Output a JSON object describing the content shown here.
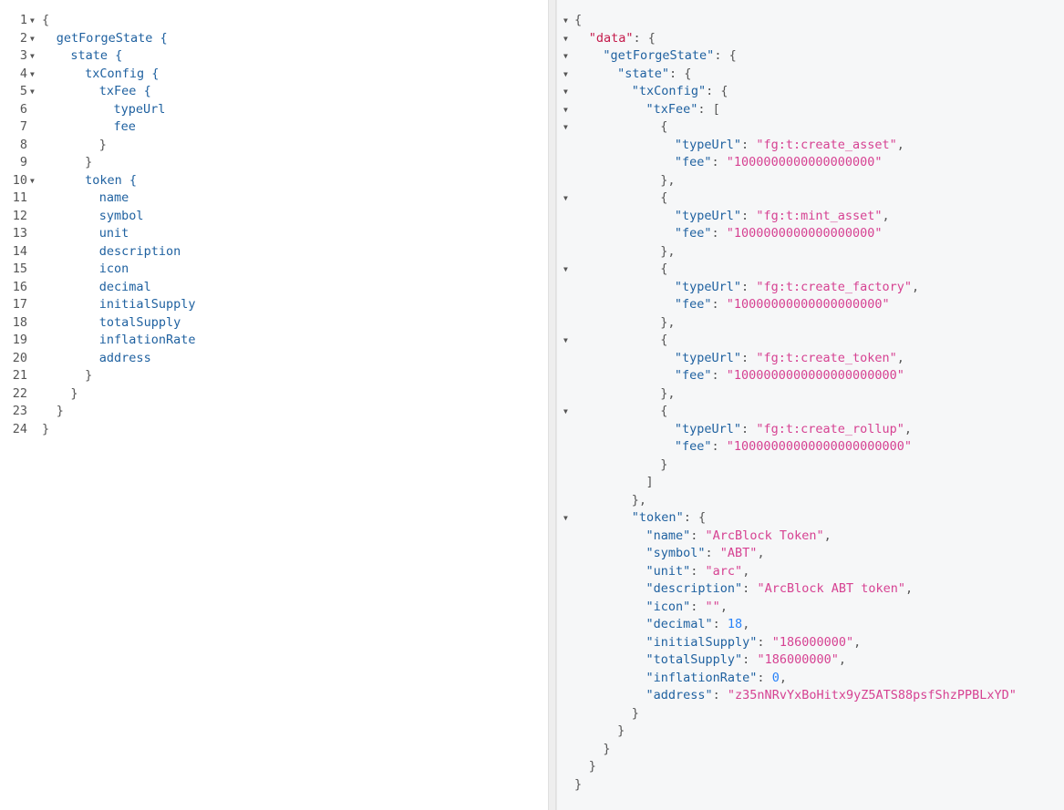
{
  "query_editor": {
    "lines": [
      {
        "n": "1",
        "fold": true,
        "indent": 0,
        "text": "{"
      },
      {
        "n": "2",
        "fold": true,
        "indent": 1,
        "text": "getForgeState {"
      },
      {
        "n": "3",
        "fold": true,
        "indent": 2,
        "text": "state {"
      },
      {
        "n": "4",
        "fold": true,
        "indent": 3,
        "text": "txConfig {"
      },
      {
        "n": "5",
        "fold": true,
        "indent": 4,
        "text": "txFee {"
      },
      {
        "n": "6",
        "fold": false,
        "indent": 5,
        "text": "typeUrl"
      },
      {
        "n": "7",
        "fold": false,
        "indent": 5,
        "text": "fee"
      },
      {
        "n": "8",
        "fold": false,
        "indent": 4,
        "text": "}"
      },
      {
        "n": "9",
        "fold": false,
        "indent": 3,
        "text": "}"
      },
      {
        "n": "10",
        "fold": true,
        "indent": 3,
        "text": "token {"
      },
      {
        "n": "11",
        "fold": false,
        "indent": 4,
        "text": "name"
      },
      {
        "n": "12",
        "fold": false,
        "indent": 4,
        "text": "symbol"
      },
      {
        "n": "13",
        "fold": false,
        "indent": 4,
        "text": "unit"
      },
      {
        "n": "14",
        "fold": false,
        "indent": 4,
        "text": "description"
      },
      {
        "n": "15",
        "fold": false,
        "indent": 4,
        "text": "icon"
      },
      {
        "n": "16",
        "fold": false,
        "indent": 4,
        "text": "decimal"
      },
      {
        "n": "17",
        "fold": false,
        "indent": 4,
        "text": "initialSupply"
      },
      {
        "n": "18",
        "fold": false,
        "indent": 4,
        "text": "totalSupply"
      },
      {
        "n": "19",
        "fold": false,
        "indent": 4,
        "text": "inflationRate"
      },
      {
        "n": "20",
        "fold": false,
        "indent": 4,
        "text": "address"
      },
      {
        "n": "21",
        "fold": false,
        "indent": 3,
        "text": "}"
      },
      {
        "n": "22",
        "fold": false,
        "indent": 2,
        "text": "}"
      },
      {
        "n": "23",
        "fold": false,
        "indent": 1,
        "text": "}"
      },
      {
        "n": "24",
        "fold": false,
        "indent": 0,
        "text": "}"
      }
    ]
  },
  "result_viewer": {
    "lines": [
      {
        "fold": true,
        "indent": 0,
        "parts": [
          [
            "punc",
            "{"
          ]
        ]
      },
      {
        "fold": true,
        "indent": 1,
        "parts": [
          [
            "datakey",
            "\"data\""
          ],
          [
            "punc",
            ": {"
          ]
        ]
      },
      {
        "fold": true,
        "indent": 2,
        "parts": [
          [
            "key",
            "\"getForgeState\""
          ],
          [
            "punc",
            ": {"
          ]
        ]
      },
      {
        "fold": true,
        "indent": 3,
        "parts": [
          [
            "key",
            "\"state\""
          ],
          [
            "punc",
            ": {"
          ]
        ]
      },
      {
        "fold": true,
        "indent": 4,
        "parts": [
          [
            "key",
            "\"txConfig\""
          ],
          [
            "punc",
            ": {"
          ]
        ]
      },
      {
        "fold": true,
        "indent": 5,
        "parts": [
          [
            "key",
            "\"txFee\""
          ],
          [
            "punc",
            ": ["
          ]
        ]
      },
      {
        "fold": true,
        "indent": 6,
        "parts": [
          [
            "punc",
            "{"
          ]
        ]
      },
      {
        "fold": false,
        "indent": 7,
        "parts": [
          [
            "key",
            "\"typeUrl\""
          ],
          [
            "punc",
            ": "
          ],
          [
            "str",
            "\"fg:t:create_asset\""
          ],
          [
            "punc",
            ","
          ]
        ]
      },
      {
        "fold": false,
        "indent": 7,
        "parts": [
          [
            "key",
            "\"fee\""
          ],
          [
            "punc",
            ": "
          ],
          [
            "str",
            "\"1000000000000000000\""
          ]
        ]
      },
      {
        "fold": false,
        "indent": 6,
        "parts": [
          [
            "punc",
            "},"
          ]
        ]
      },
      {
        "fold": true,
        "indent": 6,
        "parts": [
          [
            "punc",
            "{"
          ]
        ]
      },
      {
        "fold": false,
        "indent": 7,
        "parts": [
          [
            "key",
            "\"typeUrl\""
          ],
          [
            "punc",
            ": "
          ],
          [
            "str",
            "\"fg:t:mint_asset\""
          ],
          [
            "punc",
            ","
          ]
        ]
      },
      {
        "fold": false,
        "indent": 7,
        "parts": [
          [
            "key",
            "\"fee\""
          ],
          [
            "punc",
            ": "
          ],
          [
            "str",
            "\"1000000000000000000\""
          ]
        ]
      },
      {
        "fold": false,
        "indent": 6,
        "parts": [
          [
            "punc",
            "},"
          ]
        ]
      },
      {
        "fold": true,
        "indent": 6,
        "parts": [
          [
            "punc",
            "{"
          ]
        ]
      },
      {
        "fold": false,
        "indent": 7,
        "parts": [
          [
            "key",
            "\"typeUrl\""
          ],
          [
            "punc",
            ": "
          ],
          [
            "str",
            "\"fg:t:create_factory\""
          ],
          [
            "punc",
            ","
          ]
        ]
      },
      {
        "fold": false,
        "indent": 7,
        "parts": [
          [
            "key",
            "\"fee\""
          ],
          [
            "punc",
            ": "
          ],
          [
            "str",
            "\"10000000000000000000\""
          ]
        ]
      },
      {
        "fold": false,
        "indent": 6,
        "parts": [
          [
            "punc",
            "},"
          ]
        ]
      },
      {
        "fold": true,
        "indent": 6,
        "parts": [
          [
            "punc",
            "{"
          ]
        ]
      },
      {
        "fold": false,
        "indent": 7,
        "parts": [
          [
            "key",
            "\"typeUrl\""
          ],
          [
            "punc",
            ": "
          ],
          [
            "str",
            "\"fg:t:create_token\""
          ],
          [
            "punc",
            ","
          ]
        ]
      },
      {
        "fold": false,
        "indent": 7,
        "parts": [
          [
            "key",
            "\"fee\""
          ],
          [
            "punc",
            ": "
          ],
          [
            "str",
            "\"1000000000000000000000\""
          ]
        ]
      },
      {
        "fold": false,
        "indent": 6,
        "parts": [
          [
            "punc",
            "},"
          ]
        ]
      },
      {
        "fold": true,
        "indent": 6,
        "parts": [
          [
            "punc",
            "{"
          ]
        ]
      },
      {
        "fold": false,
        "indent": 7,
        "parts": [
          [
            "key",
            "\"typeUrl\""
          ],
          [
            "punc",
            ": "
          ],
          [
            "str",
            "\"fg:t:create_rollup\""
          ],
          [
            "punc",
            ","
          ]
        ]
      },
      {
        "fold": false,
        "indent": 7,
        "parts": [
          [
            "key",
            "\"fee\""
          ],
          [
            "punc",
            ": "
          ],
          [
            "str",
            "\"10000000000000000000000\""
          ]
        ]
      },
      {
        "fold": false,
        "indent": 6,
        "parts": [
          [
            "punc",
            "}"
          ]
        ]
      },
      {
        "fold": false,
        "indent": 5,
        "parts": [
          [
            "punc",
            "]"
          ]
        ]
      },
      {
        "fold": false,
        "indent": 4,
        "parts": [
          [
            "punc",
            "},"
          ]
        ]
      },
      {
        "fold": true,
        "indent": 4,
        "parts": [
          [
            "key",
            "\"token\""
          ],
          [
            "punc",
            ": {"
          ]
        ]
      },
      {
        "fold": false,
        "indent": 5,
        "parts": [
          [
            "key",
            "\"name\""
          ],
          [
            "punc",
            ": "
          ],
          [
            "str",
            "\"ArcBlock Token\""
          ],
          [
            "punc",
            ","
          ]
        ]
      },
      {
        "fold": false,
        "indent": 5,
        "parts": [
          [
            "key",
            "\"symbol\""
          ],
          [
            "punc",
            ": "
          ],
          [
            "str",
            "\"ABT\""
          ],
          [
            "punc",
            ","
          ]
        ]
      },
      {
        "fold": false,
        "indent": 5,
        "parts": [
          [
            "key",
            "\"unit\""
          ],
          [
            "punc",
            ": "
          ],
          [
            "str",
            "\"arc\""
          ],
          [
            "punc",
            ","
          ]
        ]
      },
      {
        "fold": false,
        "indent": 5,
        "parts": [
          [
            "key",
            "\"description\""
          ],
          [
            "punc",
            ": "
          ],
          [
            "str",
            "\"ArcBlock ABT token\""
          ],
          [
            "punc",
            ","
          ]
        ]
      },
      {
        "fold": false,
        "indent": 5,
        "parts": [
          [
            "key",
            "\"icon\""
          ],
          [
            "punc",
            ": "
          ],
          [
            "str",
            "\"\""
          ],
          [
            "punc",
            ","
          ]
        ]
      },
      {
        "fold": false,
        "indent": 5,
        "parts": [
          [
            "key",
            "\"decimal\""
          ],
          [
            "punc",
            ": "
          ],
          [
            "num",
            "18"
          ],
          [
            "punc",
            ","
          ]
        ]
      },
      {
        "fold": false,
        "indent": 5,
        "parts": [
          [
            "key",
            "\"initialSupply\""
          ],
          [
            "punc",
            ": "
          ],
          [
            "str",
            "\"186000000\""
          ],
          [
            "punc",
            ","
          ]
        ]
      },
      {
        "fold": false,
        "indent": 5,
        "parts": [
          [
            "key",
            "\"totalSupply\""
          ],
          [
            "punc",
            ": "
          ],
          [
            "str",
            "\"186000000\""
          ],
          [
            "punc",
            ","
          ]
        ]
      },
      {
        "fold": false,
        "indent": 5,
        "parts": [
          [
            "key",
            "\"inflationRate\""
          ],
          [
            "punc",
            ": "
          ],
          [
            "num",
            "0"
          ],
          [
            "punc",
            ","
          ]
        ]
      },
      {
        "fold": false,
        "indent": 5,
        "parts": [
          [
            "key",
            "\"address\""
          ],
          [
            "punc",
            ": "
          ],
          [
            "str",
            "\"z35nNRvYxBoHitx9yZ5ATS88psfShzPPBLxYD\""
          ]
        ]
      },
      {
        "fold": false,
        "indent": 4,
        "parts": [
          [
            "punc",
            "}"
          ]
        ]
      },
      {
        "fold": false,
        "indent": 3,
        "parts": [
          [
            "punc",
            "}"
          ]
        ]
      },
      {
        "fold": false,
        "indent": 2,
        "parts": [
          [
            "punc",
            "}"
          ]
        ]
      },
      {
        "fold": false,
        "indent": 1,
        "parts": [
          [
            "punc",
            "}"
          ]
        ]
      },
      {
        "fold": false,
        "indent": 0,
        "parts": [
          [
            "punc",
            "}"
          ]
        ]
      }
    ]
  },
  "icons": {
    "fold": "caret-down-icon"
  }
}
